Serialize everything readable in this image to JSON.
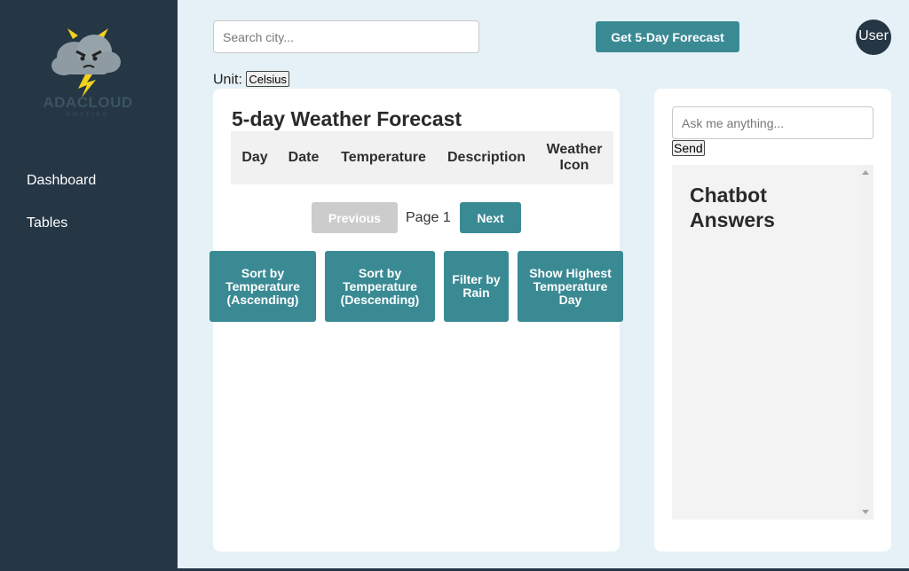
{
  "brand": {
    "name": "ADACLOUD",
    "tagline": "HOSTING"
  },
  "sidebar": {
    "items": [
      {
        "label": "Dashboard"
      },
      {
        "label": "Tables"
      }
    ]
  },
  "header": {
    "search_placeholder": "Search city...",
    "forecast_button": "Get 5-Day Forecast",
    "user_label": "User"
  },
  "unit": {
    "label": "Unit:",
    "value": "Celsius"
  },
  "forecast": {
    "title": "5-day Weather Forecast",
    "columns": [
      "Day",
      "Date",
      "Temperature",
      "Description",
      "Weather Icon"
    ],
    "pager": {
      "previous": "Previous",
      "page": "Page 1",
      "next": "Next"
    },
    "actions": [
      "Sort by Temperature (Ascending)",
      "Sort by Temperature (Descending)",
      "Filter by Rain",
      "Show Highest Temperature Day"
    ]
  },
  "chat": {
    "placeholder": "Ask me anything...",
    "send": "Send",
    "answers_title": "Chatbot Answers"
  },
  "colors": {
    "sidebar": "#253645",
    "accent": "#3a8a94",
    "background": "#e6f1f7"
  },
  "icons": {
    "logo": "angry-storm-cloud-icon"
  }
}
